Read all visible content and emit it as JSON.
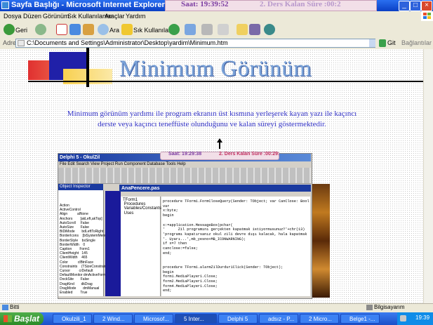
{
  "window": {
    "title": "Sayfa Başlığı - Microsoft Internet Explorer",
    "ticker_clock": "Saat: 19:39:52",
    "ticker_remaining": "2. Ders Kalan Süre :00:2"
  },
  "menu": [
    "Dosya",
    "Düzen",
    "Görünüm",
    "Sık Kullanılanlar",
    "Araçlar",
    "Yardım"
  ],
  "toolbar": {
    "back": "Geri",
    "search": "Ara",
    "favorites": "Sık Kullanılanlar"
  },
  "address": {
    "label": "Adres",
    "url": "C:\\Documents and Settings\\Administrator\\Desktop\\yardim\\Minimum.htm",
    "go": "Git",
    "links": "Bağlantılar"
  },
  "page": {
    "heading": "Minimum Görünüm",
    "paragraph": "Minimum görünüm yardımı ile program ekranın üst kısmına yerleşerek kayan yazı ile kaçıncı derste veya kaçıncı teneffüste olunduğunu ve kalan süreyi göstermektedir."
  },
  "embedded": {
    "ticker_clock": "Saat: 19:29:38",
    "ticker_remaining": "2. Ders Kalan Süre :00:29:",
    "title": "Delphi 5 - OkulZil",
    "menu": "File  Edit  Search  View  Project  Run  Component  Database  Tools  Help",
    "inspector_title": "Object Inspector",
    "properties": "Action\nActiveControl\nAlign          alNone\nAnchors        [akLeft,akTop]\nAutoScroll     False\nAutoSize       False\nBiDiMode       bdLeftToRight\nBorderIcons    [biSystemMenu]\nBorderStyle    bsSingle\nBorderWidth    0\nCaption        Form1\nClientHeight   145\nClientWidth    465\nColor          clBtnFace\nConstraints    (TSizeConstraints)\nCursor         crDefault\nDefaultMonitor dmActiveForm\nDockSite       False\nDragKind       dkDrag\nDragMode       dmManual\nEnabled        True",
    "editor_title": "AnaPencere.pas",
    "tree": "TForm1\n Procedures\n Variables/Constants\n Uses",
    "code": "procedure TForm1.FormCloseQuery(Sender: TObject; var CanClose: Bool\nvar\nx:byte;\nbegin\n\nx:=application.MessageBox(pchar(\n'      Zil programını gerçekten kapatmak istiyormusunuz?'+chr(13)\n'programı kapatırsanız okul zili devre dışı kalacak, hala kapatmak\n'. Uyarı...',mb_yesno+MB_ICONWARNING);\nif x=7 then\ncanclose:=false;\nend;\n\n\nprocedure TForm1.alarmZilDurdur1Click(Sender: TObject);\nbegin\nform1.MediaPlayer1.Close;\nform2.MediaPlayer1.Close;\nform4.MediaPlayer1.Close;\nend;"
  },
  "status": {
    "text": "Bitti",
    "zone": "Bilgisayarım"
  },
  "taskbar": {
    "start": "Başlat",
    "tasks": [
      "Okulzili_1",
      "2 Wind...",
      "Microsof...",
      "5 Inter...",
      "Delphi 5",
      "adsız - P...",
      "2 Micro...",
      "Belge1 -..."
    ],
    "clock": "19:39"
  },
  "colors": {
    "title_blue": "#0a3fc4",
    "heading": "#7aa2d8",
    "paragraph": "#3434c8",
    "ticker_purple": "#7a3aa0"
  }
}
